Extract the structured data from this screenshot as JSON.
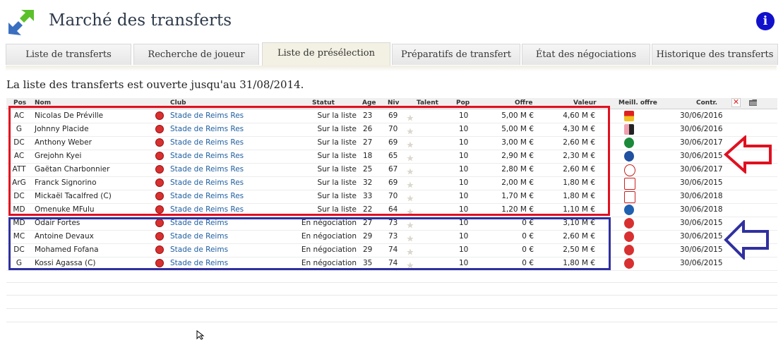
{
  "header": {
    "title": "Marché des transferts",
    "info_label": "i"
  },
  "tabs": [
    {
      "label": "Liste de transferts",
      "active": false
    },
    {
      "label": "Recherche de joueur",
      "active": false
    },
    {
      "label": "Liste de présélection",
      "active": true
    },
    {
      "label": "Préparatifs de transfert",
      "active": false
    },
    {
      "label": "État des négociations",
      "active": false
    },
    {
      "label": "Historique des transferts",
      "active": false
    }
  ],
  "notice": "La liste des transferts est ouverte jusqu'au 31/08/2014.",
  "table": {
    "columns": {
      "pos": "Pos",
      "nom": "Nom",
      "club": "Club",
      "statut": "Statut",
      "age": "Age",
      "niv": "Niv",
      "talent": "Talent",
      "pop": "Pop",
      "offre": "Offre",
      "valeur": "Valeur",
      "meill": "Meill. offre",
      "contr": "Contr."
    },
    "rows": [
      {
        "pos": "AC",
        "nom": "Nicolas De Préville",
        "club": "Stade de Reims Res",
        "statut": "Sur la liste",
        "age": "23",
        "niv": "69",
        "talent": 3,
        "pop": "10",
        "offre": "5,00 M €",
        "valeur": "4,60 M €",
        "crest": "rc-lens-crest",
        "contr": "30/06/2016"
      },
      {
        "pos": "G",
        "nom": "Johnny Placide",
        "club": "Stade de Reims Res",
        "statut": "Sur la liste",
        "age": "26",
        "niv": "70",
        "talent": 3,
        "pop": "10",
        "offre": "5,00 M €",
        "valeur": "4,30 M €",
        "crest": "palermo-crest",
        "contr": "30/06/2016"
      },
      {
        "pos": "DC",
        "nom": "Anthony Weber",
        "club": "Stade de Reims Res",
        "statut": "Sur la liste",
        "age": "27",
        "niv": "69",
        "talent": 3,
        "pop": "10",
        "offre": "3,00 M €",
        "valeur": "2,60 M €",
        "crest": "celtic-crest",
        "contr": "30/06/2017"
      },
      {
        "pos": "AC",
        "nom": "Grejohn Kyei",
        "club": "Stade de Reims Res",
        "statut": "Sur la liste",
        "age": "18",
        "niv": "65",
        "talent": 3,
        "pop": "10",
        "offre": "2,90 M €",
        "valeur": "2,30 M €",
        "crest": "birmingham-crest",
        "contr": "30/06/2015"
      },
      {
        "pos": "ATT",
        "nom": "Gaëtan Charbonnier",
        "club": "Stade de Reims Res",
        "statut": "Sur la liste",
        "age": "25",
        "niv": "67",
        "talent": 3,
        "pop": "10",
        "offre": "2,80 M €",
        "valeur": "2,60 M €",
        "crest": "redbull-crest",
        "contr": "30/06/2017"
      },
      {
        "pos": "ArG",
        "nom": "Franck Signorino",
        "club": "Stade de Reims Res",
        "statut": "Sur la liste",
        "age": "32",
        "niv": "69",
        "talent": 3,
        "pop": "10",
        "offre": "2,00 M €",
        "valeur": "1,80 M €",
        "crest": "koln-crest",
        "contr": "30/06/2015"
      },
      {
        "pos": "DC",
        "nom": "Mickaël Tacalfred (C)",
        "club": "Stade de Reims Res",
        "statut": "Sur la liste",
        "age": "33",
        "niv": "70",
        "talent": 3,
        "pop": "10",
        "offre": "1,70 M €",
        "valeur": "1,80 M €",
        "crest": "koln-crest",
        "contr": "30/06/2018"
      },
      {
        "pos": "MD",
        "nom": "Omenuke MFulu",
        "club": "Stade de Reims Res",
        "statut": "Sur la liste",
        "age": "22",
        "niv": "64",
        "talent": 3,
        "pop": "10",
        "offre": "1,20 M €",
        "valeur": "1,10 M €",
        "crest": "schalke-crest",
        "contr": "30/06/2018"
      },
      {
        "pos": "MD",
        "nom": "Odair Fortes",
        "club": "Stade de Reims",
        "statut": "En négociation",
        "age": "27",
        "niv": "73",
        "talent": 3,
        "pop": "10",
        "offre": "0 €",
        "valeur": "3,10 M €",
        "crest": "reims-crest",
        "contr": "30/06/2015"
      },
      {
        "pos": "MC",
        "nom": "Antoine Devaux",
        "club": "Stade de Reims",
        "statut": "En négociation",
        "age": "29",
        "niv": "73",
        "talent": 3,
        "pop": "10",
        "offre": "0 €",
        "valeur": "2,60 M €",
        "crest": "reims-crest",
        "contr": "30/06/2015"
      },
      {
        "pos": "DC",
        "nom": "Mohamed Fofana",
        "club": "Stade de Reims",
        "statut": "En négociation",
        "age": "29",
        "niv": "74",
        "talent": 3.5,
        "pop": "10",
        "offre": "0 €",
        "valeur": "2,50 M €",
        "crest": "reims-crest",
        "contr": "30/06/2015"
      },
      {
        "pos": "G",
        "nom": "Kossi Agassa (C)",
        "club": "Stade de Reims",
        "statut": "En négociation",
        "age": "35",
        "niv": "74",
        "talent": 3.5,
        "pop": "10",
        "offre": "0 €",
        "valeur": "1,80 M €",
        "crest": "reims-crest",
        "contr": "30/06/2015"
      }
    ]
  },
  "colors": {
    "highlight_red": "#e01020",
    "highlight_blue": "#3030a0",
    "link": "#1f5fa0",
    "info_button": "#1111cc"
  }
}
